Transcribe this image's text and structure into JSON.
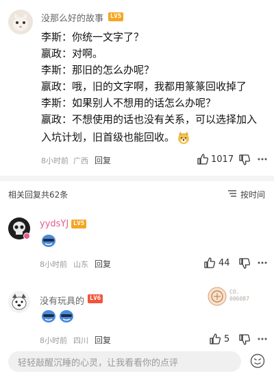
{
  "main_comment": {
    "username": "没那么好的故事",
    "level": "LV5",
    "lines": [
      "李斯：你统一文字了？",
      "嬴政：对啊。",
      "李斯：那旧的怎么办呢？",
      "嬴政：哦，旧的文字啊，我都用篆篆回收掉了",
      "李斯：如果别人不想用的话怎么办呢？",
      "嬴政：不想使用的话也没有关系，可以选择加入",
      "入坑计划，旧首级也能回收。"
    ],
    "time": "8小时前",
    "location": "广西",
    "reply_label": "回复",
    "likes": "1017"
  },
  "replies_header": {
    "count_label": "相关回复共62条",
    "sort_label": "按时间"
  },
  "replies": [
    {
      "username": "yydsYJ",
      "level": "LV5",
      "time": "8小时前",
      "location": "山东",
      "reply_label": "回复",
      "likes": "44"
    },
    {
      "username": "没有玩具的",
      "level": "LV6",
      "badge_text": "CO.\n006087",
      "time": "8小时前",
      "location": "四川",
      "reply_label": "回复",
      "likes": "5"
    }
  ],
  "bottom_bar": {
    "placeholder": "轻轻敲醒沉睡的心灵，让我看看你的点评"
  },
  "colors": {
    "lv5": "#f5a623",
    "lv6": "#f0553a",
    "meta": "#9a9a9a"
  }
}
